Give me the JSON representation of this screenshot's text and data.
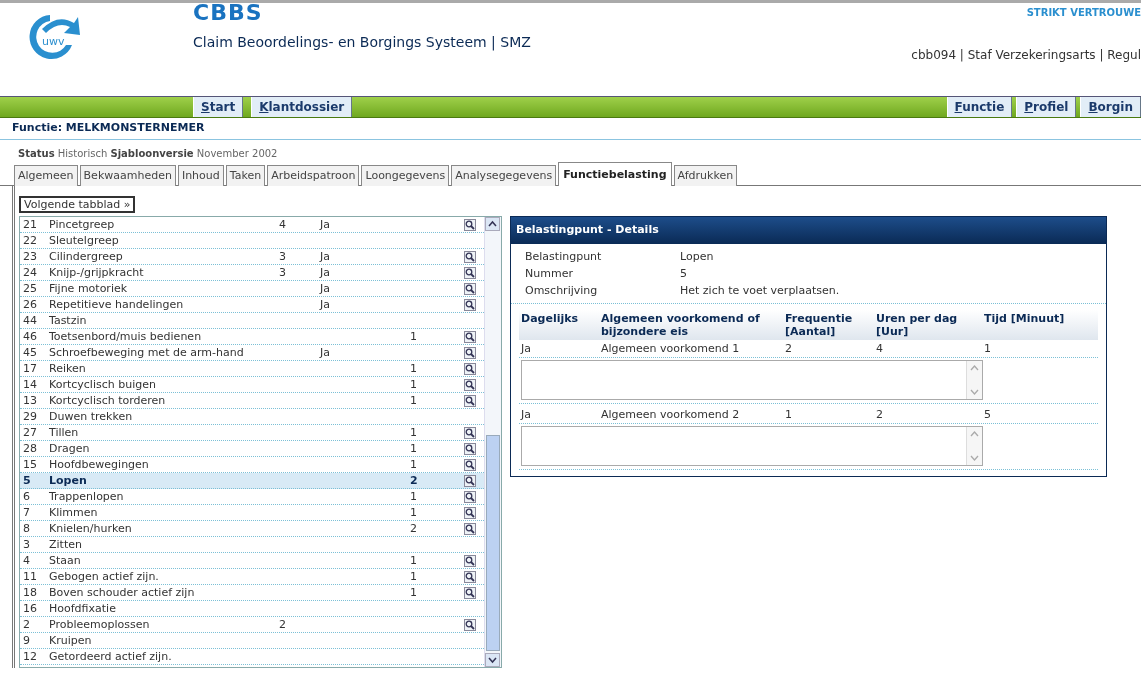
{
  "header": {
    "logo_text": "uwv",
    "app_name": "CBBS",
    "app_subtitle": "Claim Beoordelings- en Borgings Systeem | SMZ",
    "classification": "STRIKT VERTROUWE",
    "user_info": "cbb094 | Staf Verzekeringsarts | Regul"
  },
  "nav": {
    "left": [
      "Start",
      "Klantdossier"
    ],
    "right": [
      "Functie",
      "Profiel",
      "Borgin"
    ]
  },
  "page_title": "Functie: MELKMONSTERNEMER",
  "status": [
    {
      "label": "Status",
      "value": "Historisch"
    },
    {
      "label": "Sjabloonversie",
      "value": "November 2002"
    }
  ],
  "tabs": [
    {
      "label": "Algemeen",
      "selected": false
    },
    {
      "label": "Bekwaamheden",
      "selected": false
    },
    {
      "label": "Inhoud",
      "selected": false
    },
    {
      "label": "Taken",
      "selected": false
    },
    {
      "label": "Arbeidspatroon",
      "selected": false
    },
    {
      "label": "Loongegevens",
      "selected": false
    },
    {
      "label": "Analysegegevens",
      "selected": false
    },
    {
      "label": "Functiebelasting",
      "selected": true
    },
    {
      "label": "Afdrukken",
      "selected": false
    }
  ],
  "next_tab_button": "Volgende tabblad »",
  "list": [
    {
      "number": "21",
      "name": "Pincetgreep",
      "column_3": "4",
      "column_4": "Ja",
      "has_detail": true,
      "selected": false
    },
    {
      "number": "22",
      "name": "Sleutelgreep",
      "has_detail": false,
      "selected": false
    },
    {
      "number": "23",
      "name": "Cilindergreep",
      "column_3": "3",
      "column_4": "Ja",
      "has_detail": true,
      "selected": false
    },
    {
      "number": "24",
      "name": "Knijp-/grijpkracht",
      "column_3": "3",
      "column_4": "Ja",
      "has_detail": true,
      "selected": false
    },
    {
      "number": "25",
      "name": "Fijne motoriek",
      "column_4": "Ja",
      "has_detail": true,
      "selected": false
    },
    {
      "number": "26",
      "name": "Repetitieve handelingen",
      "column_4": "Ja",
      "has_detail": true,
      "selected": false
    },
    {
      "number": "44",
      "name": "Tastzin",
      "has_detail": false,
      "selected": false
    },
    {
      "number": "46",
      "name": "Toetsenbord/muis bedienen",
      "column_5": "1",
      "has_detail": true,
      "selected": false
    },
    {
      "number": "45",
      "name": "Schroefbeweging met de arm-hand",
      "column_4": "Ja",
      "has_detail": true,
      "selected": false
    },
    {
      "number": "17",
      "name": "Reiken",
      "column_5": "1",
      "has_detail": true,
      "selected": false
    },
    {
      "number": "14",
      "name": "Kortcyclisch buigen",
      "column_5": "1",
      "has_detail": true,
      "selected": false
    },
    {
      "number": "13",
      "name": "Kortcyclisch torderen",
      "column_5": "1",
      "has_detail": true,
      "selected": false
    },
    {
      "number": "29",
      "name": "Duwen trekken",
      "has_detail": false,
      "selected": false
    },
    {
      "number": "27",
      "name": "Tillen",
      "column_5": "1",
      "has_detail": true,
      "selected": false
    },
    {
      "number": "28",
      "name": "Dragen",
      "column_5": "1",
      "has_detail": true,
      "selected": false
    },
    {
      "number": "15",
      "name": "Hoofdbewegingen",
      "column_5": "1",
      "has_detail": true,
      "selected": false
    },
    {
      "number": "5",
      "name": "Lopen",
      "column_5": "2",
      "has_detail": true,
      "selected": true
    },
    {
      "number": "6",
      "name": "Trappenlopen",
      "column_5": "1",
      "has_detail": true,
      "selected": false
    },
    {
      "number": "7",
      "name": "Klimmen",
      "column_5": "1",
      "has_detail": true,
      "selected": false
    },
    {
      "number": "8",
      "name": "Knielen/hurken",
      "column_5": "2",
      "has_detail": true,
      "selected": false
    },
    {
      "number": "3",
      "name": "Zitten",
      "has_detail": false,
      "selected": false
    },
    {
      "number": "4",
      "name": "Staan",
      "column_5": "1",
      "has_detail": true,
      "selected": false
    },
    {
      "number": "11",
      "name": "Gebogen actief zijn.",
      "column_5": "1",
      "has_detail": true,
      "selected": false
    },
    {
      "number": "18",
      "name": "Boven schouder actief zijn",
      "column_5": "1",
      "has_detail": true,
      "selected": false
    },
    {
      "number": "16",
      "name": "Hoofdfixatie",
      "has_detail": false,
      "selected": false
    },
    {
      "number": "2",
      "name": "Probleemoplossen",
      "column_3": "2",
      "has_detail": true,
      "selected": false
    },
    {
      "number": "9",
      "name": "Kruipen",
      "has_detail": false,
      "selected": false
    },
    {
      "number": "12",
      "name": "Getordeerd actief zijn.",
      "has_detail": false,
      "selected": false
    }
  ],
  "details": {
    "title": "Belastingpunt - Details",
    "fields": [
      {
        "label": "Belastingpunt",
        "value": "Lopen"
      },
      {
        "label": "Nummer",
        "value": "5"
      },
      {
        "label": "Omschrijving",
        "value": "Het zich te voet verplaatsen."
      }
    ],
    "columns": [
      "Dagelijks",
      "Algemeen voorkomend of bijzondere eis",
      "Frequentie [Aantal]",
      "Uren per dag [Uur]",
      "Tijd [Minuut]"
    ],
    "rows": [
      [
        "Ja",
        "Algemeen voorkomend 1",
        "2",
        "4",
        "1"
      ],
      [
        "Ja",
        "Algemeen voorkomend 2",
        "1",
        "2",
        "5"
      ]
    ]
  }
}
